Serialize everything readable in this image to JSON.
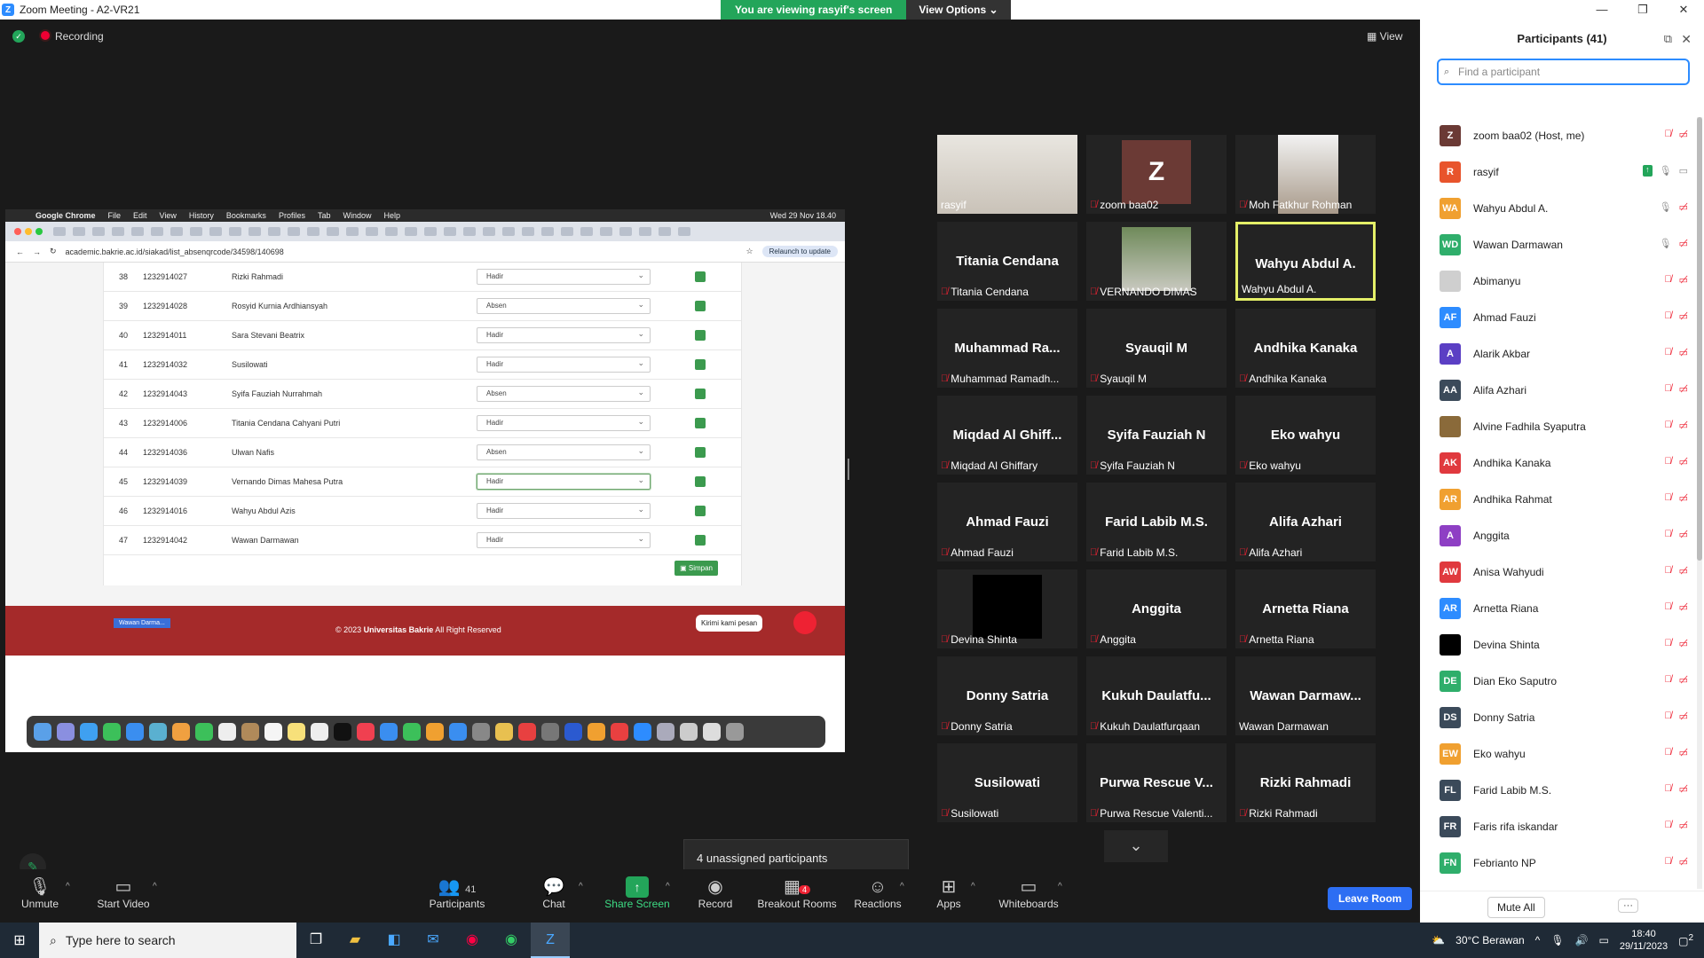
{
  "window": {
    "title": "Zoom Meeting - A2-VR21",
    "viewing_banner": "You are viewing rasyif's screen",
    "view_options": "View Options",
    "controls": [
      "—",
      "❐",
      "✕"
    ]
  },
  "meeting": {
    "recording_label": "Recording",
    "view_label": "View",
    "unassigned": "4 unassigned participants"
  },
  "shared_screen": {
    "menubar": [
      "Google Chrome",
      "File",
      "Edit",
      "View",
      "History",
      "Bookmarks",
      "Profiles",
      "Tab",
      "Window",
      "Help"
    ],
    "clock": "Wed 29 Nov  18.40",
    "url": "academic.bakrie.ac.id/siakad/list_absenqrcode/34598/140698",
    "relaunch": "Relaunch to update",
    "rows": [
      {
        "no": "38",
        "nim": "1232914027",
        "name": "Rizki Rahmadi",
        "status": "Hadir"
      },
      {
        "no": "39",
        "nim": "1232914028",
        "name": "Rosyid Kurnia Ardhiansyah",
        "status": "Absen"
      },
      {
        "no": "40",
        "nim": "1232914011",
        "name": "Sara Stevani Beatrix",
        "status": "Hadir"
      },
      {
        "no": "41",
        "nim": "1232914032",
        "name": "Susilowati",
        "status": "Hadir"
      },
      {
        "no": "42",
        "nim": "1232914043",
        "name": "Syifa Fauziah Nurrahmah",
        "status": "Absen"
      },
      {
        "no": "43",
        "nim": "1232914006",
        "name": "Titania Cendana Cahyani Putri",
        "status": "Hadir"
      },
      {
        "no": "44",
        "nim": "1232914036",
        "name": "Ulwan Nafis",
        "status": "Absen"
      },
      {
        "no": "45",
        "nim": "1232914039",
        "name": "Vernando Dimas Mahesa Putra",
        "status": "Hadir"
      },
      {
        "no": "46",
        "nim": "1232914016",
        "name": "Wahyu Abdul Azis",
        "status": "Hadir"
      },
      {
        "no": "47",
        "nim": "1232914042",
        "name": "Wawan Darmawan",
        "status": "Hadir"
      }
    ],
    "simpan": "Simpan",
    "footer_prefix": "© 2023 ",
    "footer_brand": "Universitas Bakrie",
    "footer_suffix": " All Right Reserved",
    "footer_tag": "Wawan Darma...",
    "kirim": "Kirimi kami pesan"
  },
  "tiles": [
    {
      "big": "",
      "label": "rasyif",
      "muted": false,
      "kind": "photo-rasyif"
    },
    {
      "big": "",
      "label": "zoom baa02",
      "muted": true,
      "kind": "z"
    },
    {
      "big": "",
      "label": "Moh Fatkhur Rohman",
      "muted": true,
      "kind": "photo-moh"
    },
    {
      "big": "Titania Cendana",
      "label": "Titania Cendana",
      "muted": true
    },
    {
      "big": "",
      "label": "VERNANDO DIMAS",
      "muted": true,
      "kind": "photo-vernando"
    },
    {
      "big": "Wahyu Abdul A.",
      "label": "Wahyu Abdul A.",
      "muted": false,
      "active": true
    },
    {
      "big": "Muhammad  Ra...",
      "label": "Muhammad Ramadh...",
      "muted": true
    },
    {
      "big": "Syauqil M",
      "label": "Syauqil M",
      "muted": true
    },
    {
      "big": "Andhika Kanaka",
      "label": "Andhika Kanaka",
      "muted": true
    },
    {
      "big": "Miqdad Al Ghiff...",
      "label": "Miqdad Al Ghiffary",
      "muted": true
    },
    {
      "big": "Syifa Fauziah N",
      "label": "Syifa Fauziah N",
      "muted": true
    },
    {
      "big": "Eko wahyu",
      "label": "Eko wahyu",
      "muted": true
    },
    {
      "big": "Ahmad Fauzi",
      "label": "Ahmad Fauzi",
      "muted": true
    },
    {
      "big": "Farid Labib M.S.",
      "label": "Farid Labib M.S.",
      "muted": true
    },
    {
      "big": "Alifa Azhari",
      "label": "Alifa Azhari",
      "muted": true
    },
    {
      "big": "",
      "label": "Devina Shinta",
      "muted": true,
      "kind": "black"
    },
    {
      "big": "Anggita",
      "label": "Anggita",
      "muted": true
    },
    {
      "big": "Arnetta Riana",
      "label": "Arnetta Riana",
      "muted": true
    },
    {
      "big": "Donny Satria",
      "label": "Donny Satria",
      "muted": true
    },
    {
      "big": "Kukuh  Daulatfu...",
      "label": "Kukuh Daulatfurqaan",
      "muted": true
    },
    {
      "big": "Wawan  Darmaw...",
      "label": "Wawan Darmawan",
      "muted": false
    },
    {
      "big": "Susilowati",
      "label": "Susilowati",
      "muted": true
    },
    {
      "big": "Purwa Rescue V...",
      "label": "Purwa Rescue Valenti...",
      "muted": true
    },
    {
      "big": "Rizki Rahmadi",
      "label": "Rizki Rahmadi",
      "muted": true
    }
  ],
  "toolbar": {
    "unmute": "Unmute",
    "start_video": "Start Video",
    "participants": "Participants",
    "participants_count": "41",
    "chat": "Chat",
    "share_screen": "Share Screen",
    "record": "Record",
    "breakout_rooms": "Breakout Rooms",
    "breakout_badge": "4",
    "reactions": "Reactions",
    "apps": "Apps",
    "whiteboards": "Whiteboards",
    "leave": "Leave Room"
  },
  "panel": {
    "title": "Participants (41)",
    "search_placeholder": "Find a participant",
    "mute_all": "Mute All",
    "more": "···",
    "participants": [
      {
        "initials": "Z",
        "color": "#6b3a35",
        "name": "zoom baa02 (Host, me)",
        "mic": "off",
        "cam": "off"
      },
      {
        "initials": "R",
        "color": "#e8542c",
        "name": "rasyif",
        "mic": "on",
        "cam": "on",
        "sharing": true
      },
      {
        "initials": "WA",
        "color": "#f0a030",
        "name": "Wahyu Abdul A.",
        "mic": "on",
        "cam": "off"
      },
      {
        "initials": "WD",
        "color": "#2fae6b",
        "name": "Wawan Darmawan",
        "mic": "on",
        "cam": "off"
      },
      {
        "initials": "",
        "color": "#cfcfcf",
        "name": "Abimanyu",
        "mic": "off",
        "cam": "off"
      },
      {
        "initials": "AF",
        "color": "#2d8cff",
        "name": "Ahmad Fauzi",
        "mic": "off",
        "cam": "off"
      },
      {
        "initials": "A",
        "color": "#5b3fc4",
        "name": "Alarik Akbar",
        "mic": "off",
        "cam": "off"
      },
      {
        "initials": "AA",
        "color": "#3b4a5a",
        "name": "Alifa Azhari",
        "mic": "off",
        "cam": "off"
      },
      {
        "initials": "",
        "color": "#8a6a3a",
        "name": "Alvine Fadhila Syaputra",
        "mic": "off",
        "cam": "off"
      },
      {
        "initials": "AK",
        "color": "#e0393e",
        "name": "Andhika Kanaka",
        "mic": "off",
        "cam": "off"
      },
      {
        "initials": "AR",
        "color": "#f0a030",
        "name": "Andhika Rahmat",
        "mic": "off",
        "cam": "off"
      },
      {
        "initials": "A",
        "color": "#8e3fc4",
        "name": "Anggita",
        "mic": "off",
        "cam": "off"
      },
      {
        "initials": "AW",
        "color": "#e0393e",
        "name": "Anisa Wahyudi",
        "mic": "off",
        "cam": "off"
      },
      {
        "initials": "AR",
        "color": "#2d8cff",
        "name": "Arnetta Riana",
        "mic": "off",
        "cam": "off"
      },
      {
        "initials": "",
        "color": "#000000",
        "name": "Devina Shinta",
        "mic": "off",
        "cam": "off"
      },
      {
        "initials": "DE",
        "color": "#2fae6b",
        "name": "Dian Eko Saputro",
        "mic": "off",
        "cam": "off"
      },
      {
        "initials": "DS",
        "color": "#3b4a5a",
        "name": "Donny Satria",
        "mic": "off",
        "cam": "off"
      },
      {
        "initials": "EW",
        "color": "#f0a030",
        "name": "Eko wahyu",
        "mic": "off",
        "cam": "off"
      },
      {
        "initials": "FL",
        "color": "#3b4a5a",
        "name": "Farid Labib M.S.",
        "mic": "off",
        "cam": "off"
      },
      {
        "initials": "FR",
        "color": "#3b4a5a",
        "name": "Faris rifa iskandar",
        "mic": "off",
        "cam": "off"
      },
      {
        "initials": "FN",
        "color": "#2fae6b",
        "name": "Febrianto NP",
        "mic": "off",
        "cam": "off"
      }
    ]
  },
  "taskbar": {
    "search_placeholder": "Type here to search",
    "weather": "30°C  Berawan",
    "time": "18:40",
    "date": "29/11/2023",
    "notif": "2"
  }
}
